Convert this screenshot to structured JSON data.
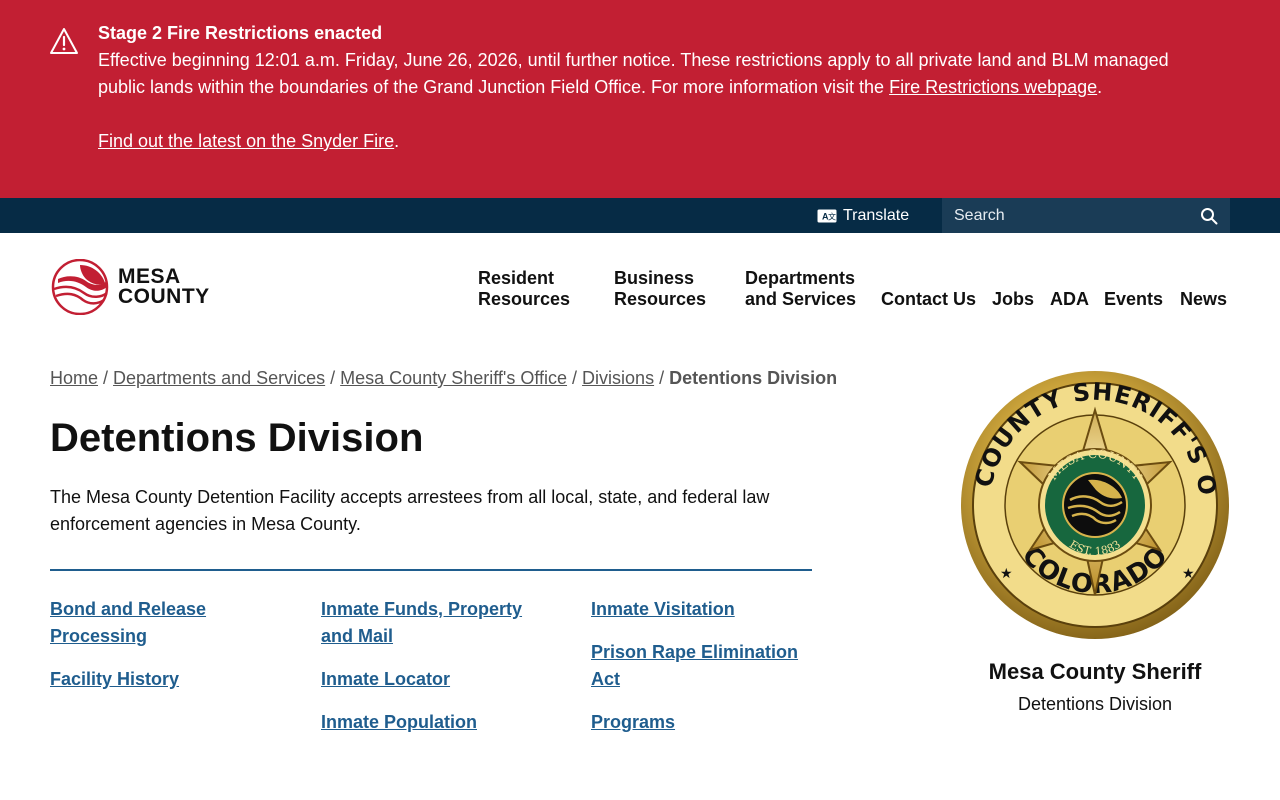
{
  "alert": {
    "title": "Stage 2 Fire Restrictions enacted",
    "text": "Effective beginning 12:01 a.m. Friday, June 26, 2026, until further notice. These restrictions apply to all private land and BLM managed public lands within the boundaries of the Grand Junction Field Office. For more information visit the ",
    "link1": "Fire Restrictions webpage",
    "link1_suffix": ".",
    "link2": "Find out the latest on the Snyder Fire",
    "link2_suffix": ".",
    "icon": "warning-triangle-icon"
  },
  "utility": {
    "translate_label": "Translate",
    "search_placeholder": "Search"
  },
  "logo": {
    "line1": "MESA",
    "line2": "COUNTY"
  },
  "nav": {
    "resident_1": "Resident",
    "resident_2": "Resources",
    "business_1": "Business",
    "business_2": "Resources",
    "departments_1": "Departments",
    "departments_2": "and Services",
    "contact": "Contact Us",
    "jobs": "Jobs",
    "ada": "ADA",
    "events": "Events",
    "news": "News"
  },
  "breadcrumb": {
    "home": "Home",
    "departments": "Departments and Services",
    "sheriff": "Mesa County Sheriff's Office",
    "divisions": "Divisions",
    "current": "Detentions Division",
    "sep": "/"
  },
  "page": {
    "title": "Detentions Division",
    "intro": "The Mesa County Detention Facility accepts arrestees from all local, state, and federal law enforcement agencies in Mesa County."
  },
  "links": {
    "bond_1": "Bond and Release",
    "bond_2": "Processing",
    "history": "Facility History",
    "funds_1": "Inmate Funds, Property",
    "funds_2": "and Mail",
    "locator": "Inmate Locator",
    "population": "Inmate Population",
    "visitation": "Inmate Visitation",
    "prea_1": "Prison Rape Elimination",
    "prea_2": "Act",
    "programs": "Programs"
  },
  "sidebar": {
    "name": "Mesa County Sheriff",
    "subtitle": "Detentions Division",
    "badge_top": "MESA COUNTY SHERIFF'S OFFICE",
    "badge_bottom": "COLORADO",
    "seal_top": "MESA COUNTY",
    "seal_bottom": "EST. 1883"
  },
  "colors": {
    "alert_bg": "#c21f33",
    "utility_bg": "#062b45",
    "link": "#1f5d8e"
  }
}
